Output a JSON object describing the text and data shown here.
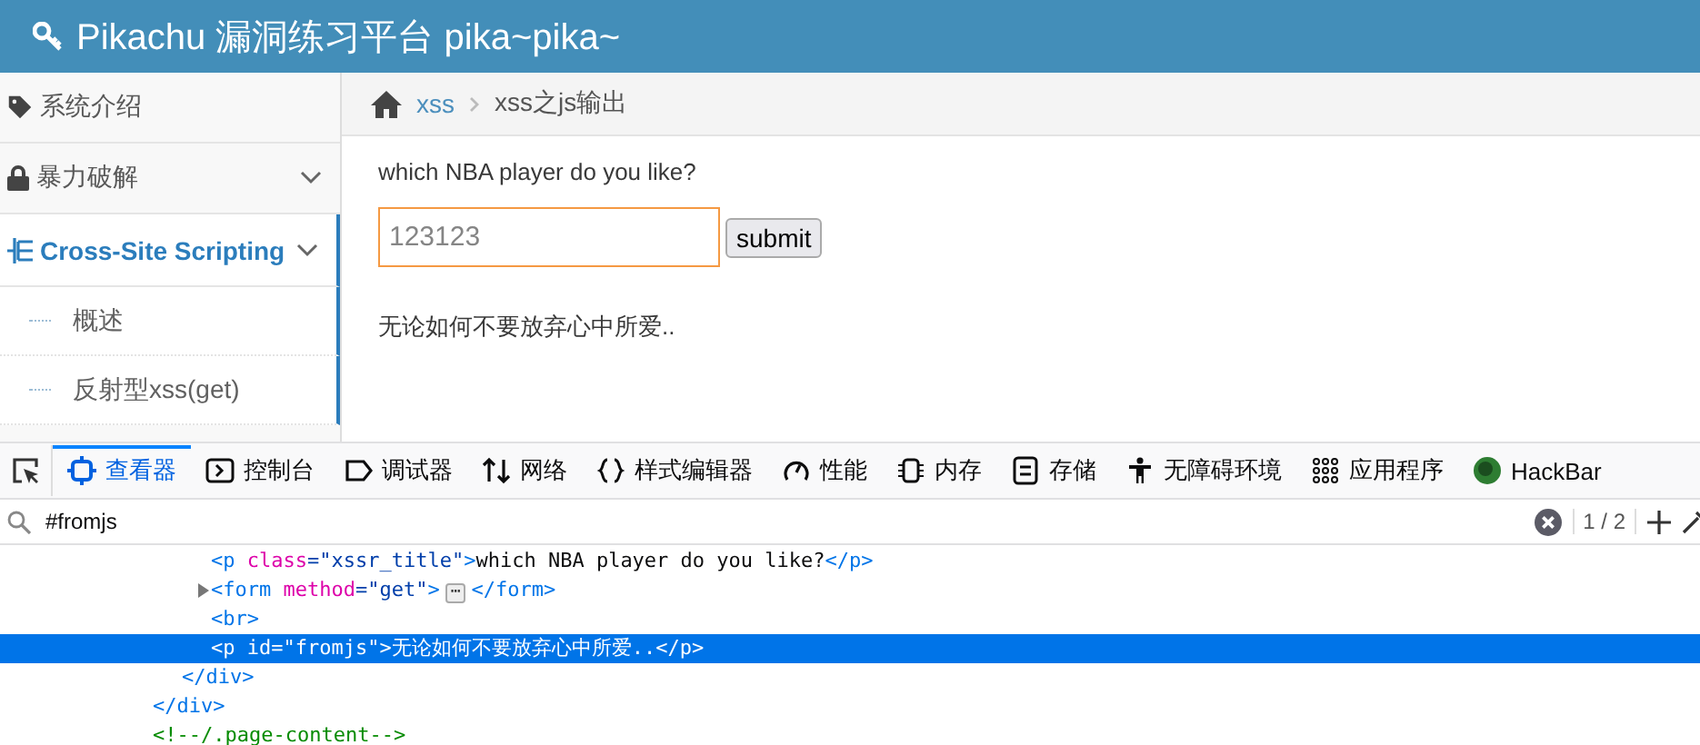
{
  "header": {
    "title": "Pikachu 漏洞练习平台 pika~pika~"
  },
  "sidebar": {
    "items": [
      {
        "label": "系统介绍",
        "selected": false,
        "has_submenu": false
      },
      {
        "label": "暴力破解",
        "selected": false,
        "has_submenu": true
      },
      {
        "label": "Cross-Site Scripting",
        "selected": true,
        "has_submenu": true,
        "children": [
          {
            "label": "概述"
          },
          {
            "label": "反射型xss(get)"
          }
        ]
      }
    ]
  },
  "breadcrumb": [
    "xss",
    "xss之js输出"
  ],
  "content": {
    "question": "which NBA player do you like?",
    "input": {
      "value": "123123"
    },
    "submit": "submit",
    "message": "无论如何不要放弃心中所爱.."
  },
  "devtools": {
    "tabs": [
      {
        "label": "查看器",
        "selected": true
      },
      {
        "label": "控制台",
        "selected": false
      },
      {
        "label": "调试器",
        "selected": false
      },
      {
        "label": "网络",
        "selected": false
      },
      {
        "label": "样式编辑器",
        "selected": false
      },
      {
        "label": "性能",
        "selected": false
      },
      {
        "label": "内存",
        "selected": false
      },
      {
        "label": "存储",
        "selected": false
      },
      {
        "label": "无障碍环境",
        "selected": false
      },
      {
        "label": "应用程序",
        "selected": false
      },
      {
        "label": "HackBar",
        "selected": false
      }
    ],
    "search": {
      "value": "#fromjs",
      "matches": "1 / 2"
    },
    "tree": [
      {
        "children": [
          {
            "children": [
              {
                "selected": false,
                "tokens": [
                  {
                    "kind": "tag",
                    "text": "<p "
                  },
                  {
                    "kind": "attr",
                    "text": "class"
                  },
                  {
                    "kind": "value",
                    "text": "=\"xssr_title\""
                  },
                  {
                    "kind": "tag",
                    "text": ">"
                  },
                  {
                    "kind": "text",
                    "text": "which NBA player do you like?"
                  },
                  {
                    "kind": "tag",
                    "text": "</p>"
                  }
                ]
              },
              {
                "selected": false,
                "collapsed": true,
                "tokens": [
                  {
                    "kind": "tag",
                    "text": "<form "
                  },
                  {
                    "kind": "attr",
                    "text": "method"
                  },
                  {
                    "kind": "value",
                    "text": "=\"get\""
                  },
                  {
                    "kind": "tag",
                    "text": ">"
                  },
                  {
                    "kind": "more",
                    "text": "⋯"
                  },
                  {
                    "kind": "tag",
                    "text": "</form>"
                  }
                ]
              },
              {
                "selected": false,
                "tokens": [
                  {
                    "kind": "tag",
                    "text": "<br>"
                  }
                ]
              },
              {
                "selected": true,
                "tokens": [
                  {
                    "kind": "tag",
                    "text": "<p "
                  },
                  {
                    "kind": "attr",
                    "text": "id"
                  },
                  {
                    "kind": "value",
                    "text": "=\"fromjs\""
                  },
                  {
                    "kind": "tag",
                    "text": ">"
                  },
                  {
                    "kind": "text",
                    "text": "无论如何不要放弃心中所爱.."
                  },
                  {
                    "kind": "tag",
                    "text": "</p>"
                  }
                ]
              }
            ],
            "close": [
              {
                "kind": "tag",
                "text": "</div>"
              }
            ]
          }
        ],
        "close": [
          {
            "kind": "tag",
            "text": "</div>"
          }
        ]
      },
      {
        "selected": false,
        "tokens": [
          {
            "kind": "comment",
            "text": "<!--/.page-content-->"
          }
        ]
      }
    ]
  }
}
